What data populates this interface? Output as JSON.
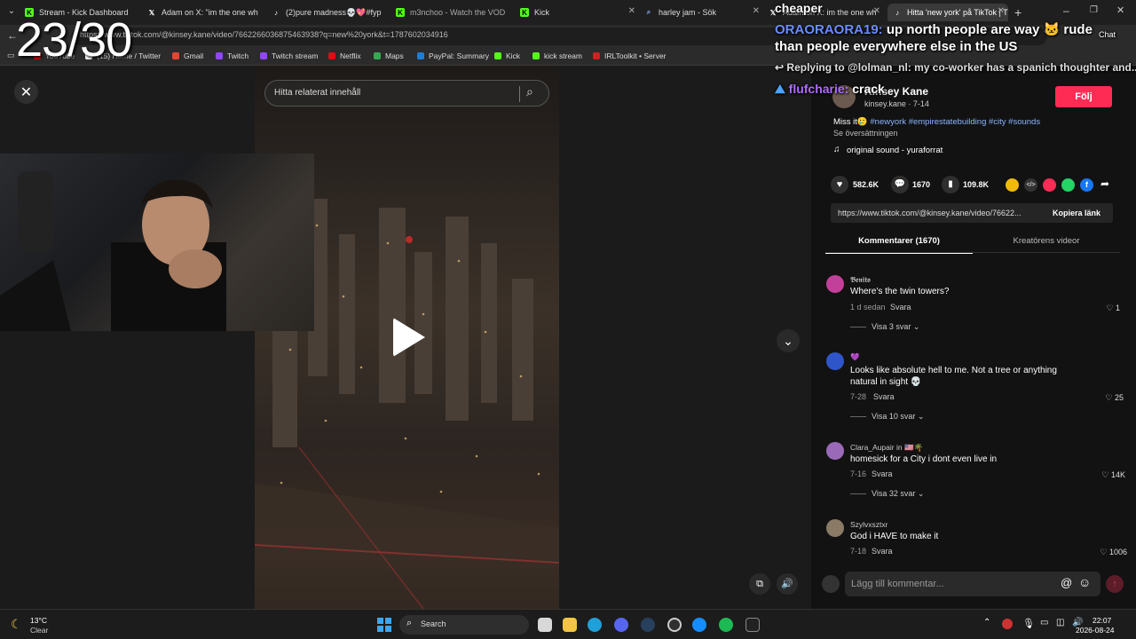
{
  "tabs": [
    {
      "label": "Stream - Kick Dashboard",
      "icon": "kick-icon"
    },
    {
      "label": "Adam on X: \"im the one wh",
      "icon": "x-icon"
    },
    {
      "label": "(2)pure madness💀💖#fyp",
      "icon": "tiktok-icon"
    },
    {
      "label": "m3nchoo - Watch the VOD",
      "icon": "kick-icon"
    },
    {
      "label": "Kick",
      "icon": "kick-icon"
    },
    {
      "label": "harley jam - Sök",
      "icon": "search-icon"
    },
    {
      "label": "Adam on X: im the one wh",
      "icon": "x-icon"
    },
    {
      "label": "Hitta 'new york' på TikTok | T",
      "icon": "tiktok-icon"
    }
  ],
  "address": {
    "url": "https://www.tiktok.com/@kinsey.kane/video/7662266036875463938?q=new%20york&t=1787602034916"
  },
  "bookmarks": [
    {
      "label": "YouTube",
      "color": "#ff0000"
    },
    {
      "label": "(15) Home / Twitter",
      "color": "#ffffff"
    },
    {
      "label": "Gmail",
      "color": "#ea4335"
    },
    {
      "label": "Twitch",
      "color": "#9146ff"
    },
    {
      "label": "Twitch stream",
      "color": "#9146ff"
    },
    {
      "label": "Netflix",
      "color": "#e50914"
    },
    {
      "label": "Maps",
      "color": "#34a853"
    },
    {
      "label": "PayPal: Summary",
      "color": "#003087"
    },
    {
      "label": "Kick",
      "color": "#53fc18"
    },
    {
      "label": "kick stream",
      "color": "#53fc18"
    },
    {
      "label": "IRLToolkit • Server",
      "color": "#cc2222"
    }
  ],
  "search": {
    "placeholder": "Hitta relaterat innehåll"
  },
  "author": {
    "name": "Kinsey Kane",
    "handle": "kinsey.kane · 7-14",
    "follow_label": "Följ"
  },
  "caption": {
    "text": "Miss it🥲",
    "hashtags": "#newyork #empirestatebuilding #city #sounds",
    "translate": "Se översättningen",
    "sound": "original sound - yuraforrat"
  },
  "stats": {
    "likes": "582.6K",
    "comments": "1670",
    "saves": "109.8K"
  },
  "link": {
    "url": "https://www.tiktok.com/@kinsey.kane/video/76622...",
    "copy_label": "Kopiera länk"
  },
  "tabs_panel": {
    "comments": "Kommentarer (1670)",
    "creator": "Kreatörens videor"
  },
  "comments": [
    {
      "user": "𝕭𝖊𝖓𝖎𝖙𝖔",
      "text": "Where's the twin towers?",
      "date": "1 d sedan",
      "reply": "Svara",
      "likes": "1",
      "replies": "Visa 3 svar",
      "avatar_color": "#c2409a"
    },
    {
      "user": "💜",
      "text": "Looks like absolute hell to me. Not a tree or anything natural in sight 💀",
      "date": "7-28",
      "reply": "Svara",
      "likes": "25",
      "replies": "Visa 10 svar",
      "avatar_color": "#2f56c9"
    },
    {
      "user": "Clara_Aupair in 🇺🇸🌴",
      "text": "homesick for a City i dont even live in",
      "date": "7-16",
      "reply": "Svara",
      "likes": "14K",
      "replies": "Visa 32 svar",
      "avatar_color": "#9a6ab8"
    },
    {
      "user": "Szylvxsztxr",
      "text": "God i HAVE to make it",
      "date": "7-18",
      "reply": "Svara",
      "likes": "1006",
      "replies": "",
      "avatar_color": "#8a7a66"
    }
  ],
  "comment_input": {
    "placeholder": "Lägg till kommentar..."
  },
  "overlay": {
    "counter": "23/30",
    "cheaper": "cheaper",
    "chat_user": "ORAORAORA19:",
    "chat_msg": "up north people are way 🐱 rude than people everywhere else in the US",
    "reply_line": "Replying to @lolman_nl: my co-worker has a spanich thoughter and...",
    "chat_user2": "flufcharie:",
    "chat_msg2": "crack",
    "chat_label": "Chat"
  },
  "taskbar": {
    "weather_temp": "13°C",
    "weather_desc": "Clear",
    "search_label": "Search",
    "time": "22:07",
    "date": "2026-08-24"
  }
}
